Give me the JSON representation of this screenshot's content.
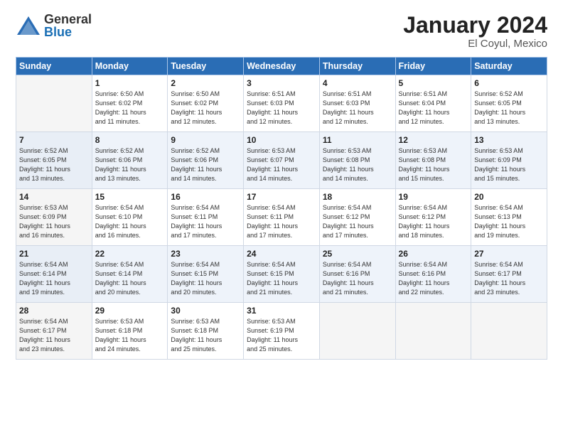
{
  "logo": {
    "general": "General",
    "blue": "Blue"
  },
  "title": "January 2024",
  "location": "El Coyul, Mexico",
  "days_of_week": [
    "Sunday",
    "Monday",
    "Tuesday",
    "Wednesday",
    "Thursday",
    "Friday",
    "Saturday"
  ],
  "weeks": [
    [
      {
        "day": "",
        "info": ""
      },
      {
        "day": "1",
        "info": "Sunrise: 6:50 AM\nSunset: 6:02 PM\nDaylight: 11 hours\nand 11 minutes."
      },
      {
        "day": "2",
        "info": "Sunrise: 6:50 AM\nSunset: 6:02 PM\nDaylight: 11 hours\nand 12 minutes."
      },
      {
        "day": "3",
        "info": "Sunrise: 6:51 AM\nSunset: 6:03 PM\nDaylight: 11 hours\nand 12 minutes."
      },
      {
        "day": "4",
        "info": "Sunrise: 6:51 AM\nSunset: 6:03 PM\nDaylight: 11 hours\nand 12 minutes."
      },
      {
        "day": "5",
        "info": "Sunrise: 6:51 AM\nSunset: 6:04 PM\nDaylight: 11 hours\nand 12 minutes."
      },
      {
        "day": "6",
        "info": "Sunrise: 6:52 AM\nSunset: 6:05 PM\nDaylight: 11 hours\nand 13 minutes."
      }
    ],
    [
      {
        "day": "7",
        "info": "Sunrise: 6:52 AM\nSunset: 6:05 PM\nDaylight: 11 hours\nand 13 minutes."
      },
      {
        "day": "8",
        "info": "Sunrise: 6:52 AM\nSunset: 6:06 PM\nDaylight: 11 hours\nand 13 minutes."
      },
      {
        "day": "9",
        "info": "Sunrise: 6:52 AM\nSunset: 6:06 PM\nDaylight: 11 hours\nand 14 minutes."
      },
      {
        "day": "10",
        "info": "Sunrise: 6:53 AM\nSunset: 6:07 PM\nDaylight: 11 hours\nand 14 minutes."
      },
      {
        "day": "11",
        "info": "Sunrise: 6:53 AM\nSunset: 6:08 PM\nDaylight: 11 hours\nand 14 minutes."
      },
      {
        "day": "12",
        "info": "Sunrise: 6:53 AM\nSunset: 6:08 PM\nDaylight: 11 hours\nand 15 minutes."
      },
      {
        "day": "13",
        "info": "Sunrise: 6:53 AM\nSunset: 6:09 PM\nDaylight: 11 hours\nand 15 minutes."
      }
    ],
    [
      {
        "day": "14",
        "info": "Sunrise: 6:53 AM\nSunset: 6:09 PM\nDaylight: 11 hours\nand 16 minutes."
      },
      {
        "day": "15",
        "info": "Sunrise: 6:54 AM\nSunset: 6:10 PM\nDaylight: 11 hours\nand 16 minutes."
      },
      {
        "day": "16",
        "info": "Sunrise: 6:54 AM\nSunset: 6:11 PM\nDaylight: 11 hours\nand 17 minutes."
      },
      {
        "day": "17",
        "info": "Sunrise: 6:54 AM\nSunset: 6:11 PM\nDaylight: 11 hours\nand 17 minutes."
      },
      {
        "day": "18",
        "info": "Sunrise: 6:54 AM\nSunset: 6:12 PM\nDaylight: 11 hours\nand 17 minutes."
      },
      {
        "day": "19",
        "info": "Sunrise: 6:54 AM\nSunset: 6:12 PM\nDaylight: 11 hours\nand 18 minutes."
      },
      {
        "day": "20",
        "info": "Sunrise: 6:54 AM\nSunset: 6:13 PM\nDaylight: 11 hours\nand 19 minutes."
      }
    ],
    [
      {
        "day": "21",
        "info": "Sunrise: 6:54 AM\nSunset: 6:14 PM\nDaylight: 11 hours\nand 19 minutes."
      },
      {
        "day": "22",
        "info": "Sunrise: 6:54 AM\nSunset: 6:14 PM\nDaylight: 11 hours\nand 20 minutes."
      },
      {
        "day": "23",
        "info": "Sunrise: 6:54 AM\nSunset: 6:15 PM\nDaylight: 11 hours\nand 20 minutes."
      },
      {
        "day": "24",
        "info": "Sunrise: 6:54 AM\nSunset: 6:15 PM\nDaylight: 11 hours\nand 21 minutes."
      },
      {
        "day": "25",
        "info": "Sunrise: 6:54 AM\nSunset: 6:16 PM\nDaylight: 11 hours\nand 21 minutes."
      },
      {
        "day": "26",
        "info": "Sunrise: 6:54 AM\nSunset: 6:16 PM\nDaylight: 11 hours\nand 22 minutes."
      },
      {
        "day": "27",
        "info": "Sunrise: 6:54 AM\nSunset: 6:17 PM\nDaylight: 11 hours\nand 23 minutes."
      }
    ],
    [
      {
        "day": "28",
        "info": "Sunrise: 6:54 AM\nSunset: 6:17 PM\nDaylight: 11 hours\nand 23 minutes."
      },
      {
        "day": "29",
        "info": "Sunrise: 6:53 AM\nSunset: 6:18 PM\nDaylight: 11 hours\nand 24 minutes."
      },
      {
        "day": "30",
        "info": "Sunrise: 6:53 AM\nSunset: 6:18 PM\nDaylight: 11 hours\nand 25 minutes."
      },
      {
        "day": "31",
        "info": "Sunrise: 6:53 AM\nSunset: 6:19 PM\nDaylight: 11 hours\nand 25 minutes."
      },
      {
        "day": "",
        "info": ""
      },
      {
        "day": "",
        "info": ""
      },
      {
        "day": "",
        "info": ""
      }
    ]
  ]
}
